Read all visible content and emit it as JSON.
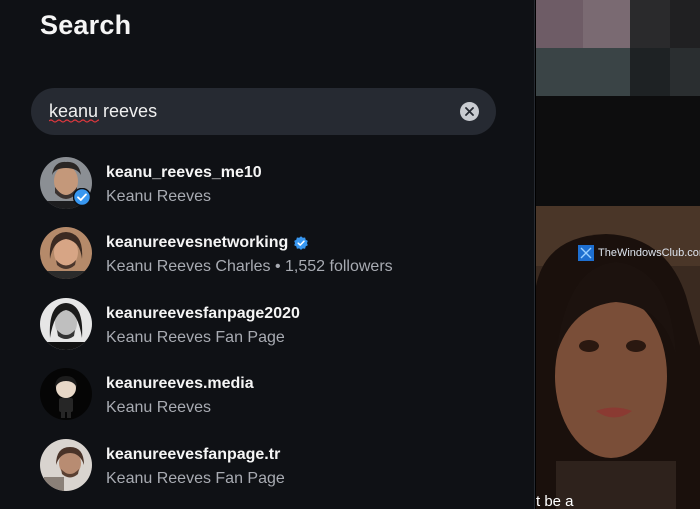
{
  "search": {
    "title": "Search",
    "query": "keanu reeves"
  },
  "results": [
    {
      "username": "keanu_reeves_me10",
      "subtitle": "Keanu Reeves",
      "verified": false,
      "avatar_badge": true
    },
    {
      "username": "keanureevesnetworking",
      "subtitle": "Keanu Reeves Charles • 1,552 followers",
      "verified": true,
      "avatar_badge": false
    },
    {
      "username": "keanureevesfanpage2020",
      "subtitle": "Keanu Reeves Fan Page",
      "verified": false,
      "avatar_badge": false
    },
    {
      "username": "keanureeves.media",
      "subtitle": "Keanu Reeves",
      "verified": false,
      "avatar_badge": false
    },
    {
      "username": "keanureevesfanpage.tr",
      "subtitle": "Keanu Reeves Fan Page",
      "verified": false,
      "avatar_badge": false
    }
  ],
  "video": {
    "watermark": "TheWindowsClub.com",
    "caption": "t be a"
  },
  "colors": {
    "panel_bg": "#0f1115",
    "search_bg": "#262a32",
    "verified_blue": "#3897f0",
    "text_primary": "#f5f5f5",
    "text_secondary": "#a8abb2"
  }
}
